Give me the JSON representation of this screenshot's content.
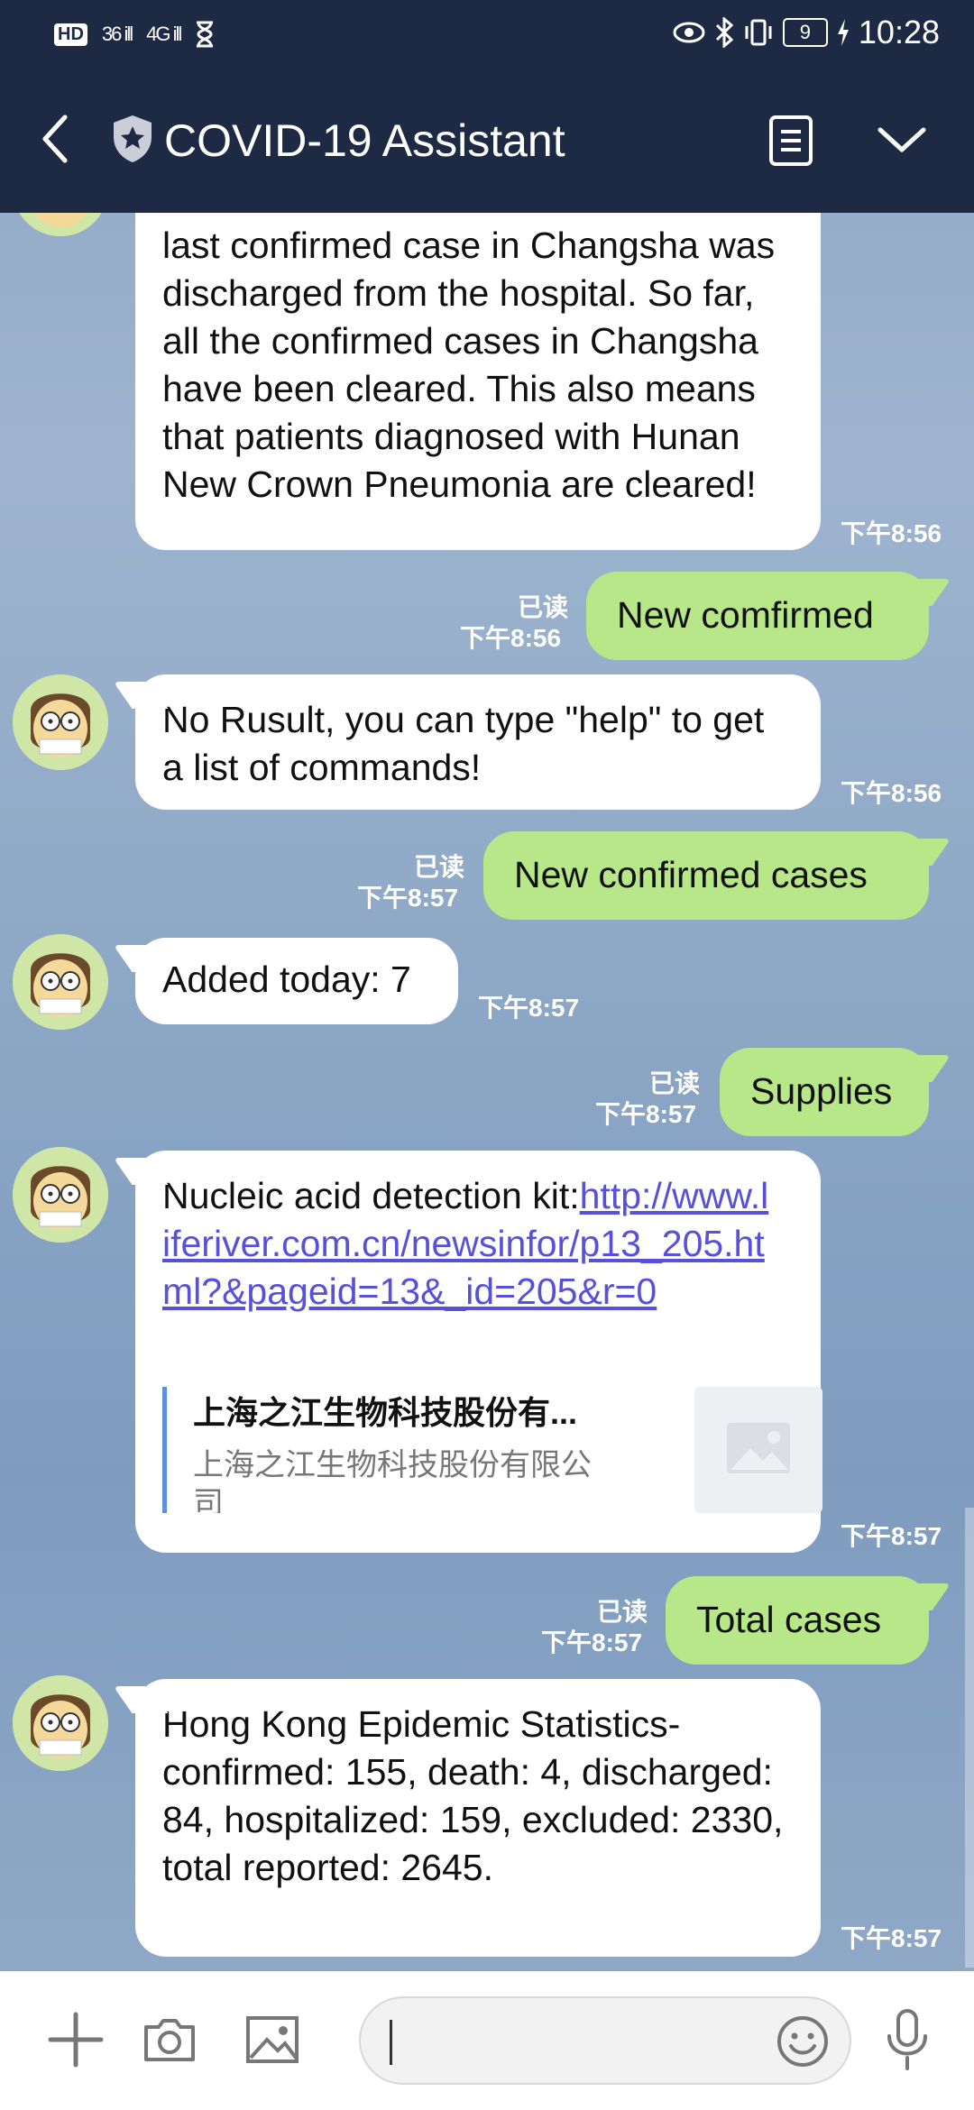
{
  "status_bar": {
    "hd": "HD",
    "signal1": "36 ill",
    "signal2": "4G ill",
    "battery": "9",
    "time": "10:28"
  },
  "header": {
    "title": "COVID-19 Assistant"
  },
  "messages": {
    "m1": {
      "text": "last confirmed case in Changsha was discharged from the hospital. So far, all the confirmed cases in Changsha have been cleared. This also means that patients diagnosed with Hunan New Crown Pneumonia are cleared!",
      "time": "下午8:56"
    },
    "m2": {
      "text": "New comfirmed",
      "read": "已读",
      "time": "下午8:56"
    },
    "m3": {
      "text": "No Rusult, you can type \"help\" to get a list of commands!",
      "time": "下午8:56"
    },
    "m4": {
      "text": "New confirmed cases",
      "read": "已读",
      "time": "下午8:57"
    },
    "m5": {
      "text": "Added today: 7",
      "time": "下午8:57"
    },
    "m6": {
      "text": "Supplies",
      "read": "已读",
      "time": "下午8:57"
    },
    "m7": {
      "label": "Nucleic acid detection kit:",
      "link": "http://www.liferiver.com.cn/newsinfor/p13_205.html?&pageid=13&_id=205&r=0",
      "preview_title": "上海之江生物科技股份有...",
      "preview_desc": "上海之江生物科技股份有限公司",
      "time": "下午8:57"
    },
    "m8": {
      "text": "Total cases",
      "read": "已读",
      "time": "下午8:57"
    },
    "m9": {
      "text": "Hong Kong Epidemic Statistics-confirmed: 155, death: 4, discharged: 84, hospitalized: 159, excluded: 2330, total reported: 2645.",
      "time": "下午8:57"
    }
  },
  "input": {
    "value": "",
    "icons": [
      "plus-icon",
      "camera-icon",
      "image-icon",
      "emoji-icon",
      "microphone-icon"
    ]
  },
  "colors": {
    "header_bg": "#1e2a44",
    "outgoing_bubble": "#b7e789",
    "incoming_bubble": "#ffffff",
    "link": "#5750d8"
  }
}
